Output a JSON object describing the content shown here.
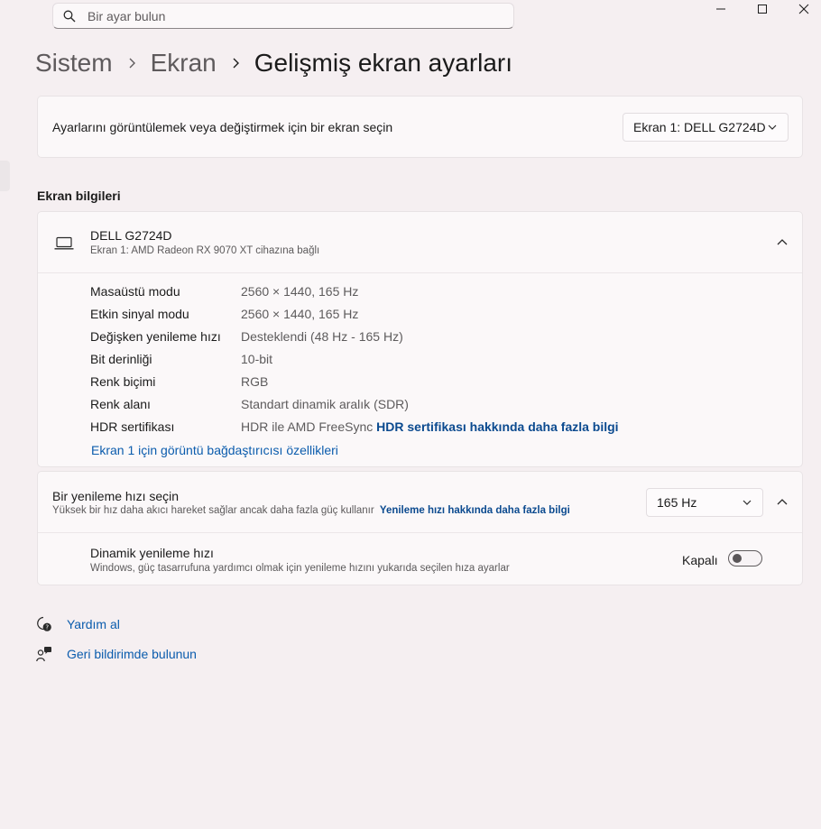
{
  "search": {
    "placeholder": "Bir ayar bulun"
  },
  "breadcrumb": {
    "level1": "Sistem",
    "level2": "Ekran",
    "current": "Gelişmiş ekran ayarları"
  },
  "display_select": {
    "label": "Ayarlarını görüntülemek veya değiştirmek için bir ekran seçin",
    "value": "Ekran 1: DELL G2724D"
  },
  "info_section": {
    "title": "Ekran bilgileri"
  },
  "monitor": {
    "name": "DELL G2724D",
    "subtitle": "Ekran 1: AMD Radeon RX 9070 XT cihazına bağlı",
    "properties": [
      {
        "key": "Masaüstü modu",
        "value": "2560 × 1440, 165 Hz"
      },
      {
        "key": "Etkin sinyal modu",
        "value": "2560 × 1440, 165 Hz"
      },
      {
        "key": "Değişken yenileme hızı",
        "value": "Desteklendi (48 Hz - 165 Hz)"
      },
      {
        "key": "Bit derinliği",
        "value": "10-bit"
      },
      {
        "key": "Renk biçimi",
        "value": "RGB"
      },
      {
        "key": "Renk alanı",
        "value": "Standart dinamik aralık (SDR)"
      },
      {
        "key": "HDR sertifikası",
        "value": "HDR ile AMD FreeSync",
        "link": "HDR sertifikası hakkında daha fazla bilgi"
      }
    ],
    "adapter_link": "Ekran 1 için görüntü bağdaştırıcısı özellikleri"
  },
  "refresh": {
    "title": "Bir yenileme hızı seçin",
    "description": "Yüksek bir hız daha akıcı hareket sağlar ancak daha fazla güç kullanır",
    "link": "Yenileme hızı hakkında daha fazla bilgi",
    "value": "165 Hz",
    "dynamic_title": "Dinamik yenileme hızı",
    "dynamic_description": "Windows, güç tasarrufuna yardımcı olmak için yenileme hızını yukarıda seçilen hıza ayarlar",
    "dynamic_state": "Kapalı"
  },
  "footer": {
    "help": "Yardım al",
    "feedback": "Geri bildirimde bulunun"
  },
  "colors": {
    "accent": "#0b5cad",
    "background": "#f5eff1",
    "card": "#fbf8f9"
  }
}
